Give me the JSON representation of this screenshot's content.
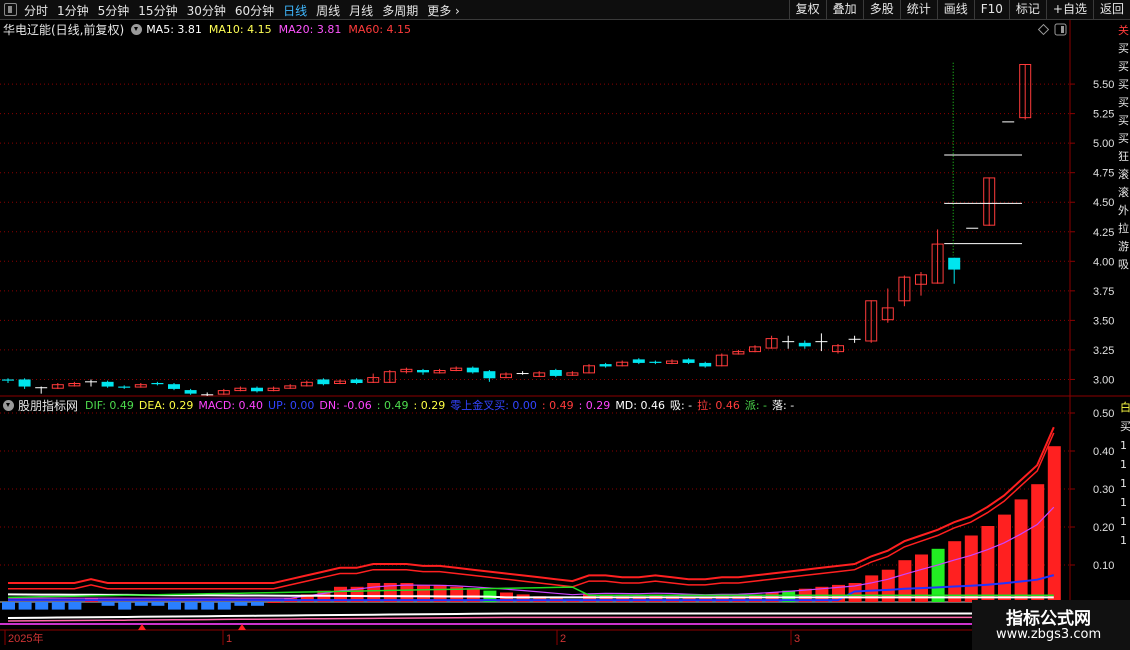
{
  "toolbar": {
    "period_tabs": [
      "分时",
      "1分钟",
      "5分钟",
      "15分钟",
      "30分钟",
      "60分钟",
      "日线",
      "周线",
      "月线",
      "多周期",
      "更多"
    ],
    "active_tab": "日线",
    "right_buttons": [
      "复权",
      "叠加",
      "多股",
      "统计",
      "画线",
      "F10",
      "标记",
      "+自选",
      "返回"
    ]
  },
  "main": {
    "stock_title": "华电辽能(日线,前复权)",
    "ma": [
      {
        "label": "MA5: 3.81",
        "color": "#ffffff"
      },
      {
        "label": "MA10: 4.15",
        "color": "#ffff55"
      },
      {
        "label": "MA20: 3.81",
        "color": "#ff55ff"
      },
      {
        "label": "MA60: 4.15",
        "color": "#ff3b3b"
      }
    ],
    "y_axis": [
      "5.50",
      "5.25",
      "5.00",
      "4.75",
      "4.50",
      "4.25",
      "4.00",
      "3.75",
      "3.50",
      "3.25",
      "3.00"
    ],
    "y_range": [
      2.86,
      5.89
    ],
    "right_strip_chars": [
      "关",
      "买",
      "买",
      "买",
      "买",
      "买",
      "买",
      "狂",
      "滚",
      "滚",
      "外",
      "拉",
      "游",
      "吸"
    ]
  },
  "indicator": {
    "name": "股朋指标网",
    "legend": [
      {
        "text": "DIF: 0.49",
        "color": "#4ddc4d"
      },
      {
        "text": "DEA: 0.29",
        "color": "#ffff44"
      },
      {
        "text": "MACD: 0.40",
        "color": "#ff44ff"
      },
      {
        "text": "UP: 0.00",
        "color": "#3344ff"
      },
      {
        "text": "DN: -0.06",
        "color": "#ff44ff"
      },
      {
        "text": ": 0.49",
        "color": "#4ddc4d"
      },
      {
        "text": ": 0.29",
        "color": "#ffff44"
      },
      {
        "text": "零上金叉买: 0.00",
        "color": "#3344ff"
      },
      {
        "text": ": 0.49",
        "color": "#ff3b3b"
      },
      {
        "text": ": 0.29",
        "color": "#ff44ff"
      },
      {
        "text": "MD: 0.46",
        "color": "#ffffff"
      },
      {
        "text": "吸: -",
        "color": "#ffffff"
      },
      {
        "text": "拉: 0.46",
        "color": "#ff3b3b"
      },
      {
        "text": "派: -",
        "color": "#4ddc4d"
      },
      {
        "text": "落: -",
        "color": "#ffffff"
      }
    ],
    "y_axis": [
      "0.50",
      "0.40",
      "0.30",
      "0.20",
      "0.10"
    ],
    "right_strip_chars": [
      "白",
      "买",
      "1",
      "1",
      "1",
      "1",
      "1",
      "1"
    ]
  },
  "x_axis": [
    "2025年",
    "1",
    "2",
    "3"
  ],
  "watermark": {
    "title": "指标公式网",
    "url": "www.zbgs3.com"
  },
  "colors": {
    "up": "#ff3b3b",
    "down": "#00e5ee",
    "grid": "#8b0000",
    "axis_text": "#e0e0e0"
  },
  "chart_data": [
    {
      "type": "candlestick",
      "title": "华电辽能(日线,前复权)",
      "ylim": [
        2.86,
        5.89
      ],
      "candles": [
        {
          "o": 3.0,
          "c": 2.99,
          "h": 3.01,
          "l": 2.97
        },
        {
          "o": 3.0,
          "c": 2.94,
          "h": 3.01,
          "l": 2.92
        },
        {
          "o": 2.93,
          "c": 2.93,
          "h": 2.94,
          "l": 2.88
        },
        {
          "o": 2.93,
          "c": 2.96,
          "h": 2.97,
          "l": 2.92
        },
        {
          "o": 2.95,
          "c": 2.97,
          "h": 2.98,
          "l": 2.94
        },
        {
          "o": 2.98,
          "c": 2.98,
          "h": 3.0,
          "l": 2.94
        },
        {
          "o": 2.98,
          "c": 2.94,
          "h": 2.99,
          "l": 2.93
        },
        {
          "o": 2.94,
          "c": 2.93,
          "h": 2.95,
          "l": 2.92
        },
        {
          "o": 2.94,
          "c": 2.96,
          "h": 2.97,
          "l": 2.93
        },
        {
          "o": 2.97,
          "c": 2.96,
          "h": 2.98,
          "l": 2.95
        },
        {
          "o": 2.96,
          "c": 2.92,
          "h": 2.97,
          "l": 2.91
        },
        {
          "o": 2.91,
          "c": 2.88,
          "h": 2.92,
          "l": 2.87
        },
        {
          "o": 2.87,
          "c": 2.87,
          "h": 2.89,
          "l": 2.86
        },
        {
          "o": 2.88,
          "c": 2.91,
          "h": 2.92,
          "l": 2.87
        },
        {
          "o": 2.91,
          "c": 2.93,
          "h": 2.94,
          "l": 2.9
        },
        {
          "o": 2.93,
          "c": 2.9,
          "h": 2.94,
          "l": 2.89
        },
        {
          "o": 2.91,
          "c": 2.93,
          "h": 2.94,
          "l": 2.9
        },
        {
          "o": 2.93,
          "c": 2.95,
          "h": 2.96,
          "l": 2.92
        },
        {
          "o": 2.95,
          "c": 2.98,
          "h": 2.99,
          "l": 2.94
        },
        {
          "o": 3.0,
          "c": 2.96,
          "h": 3.01,
          "l": 2.95
        },
        {
          "o": 2.97,
          "c": 2.99,
          "h": 3.0,
          "l": 2.96
        },
        {
          "o": 3.0,
          "c": 2.97,
          "h": 3.01,
          "l": 2.96
        },
        {
          "o": 2.98,
          "c": 3.02,
          "h": 3.05,
          "l": 2.97
        },
        {
          "o": 2.98,
          "c": 3.07,
          "h": 3.08,
          "l": 2.97
        },
        {
          "o": 3.07,
          "c": 3.09,
          "h": 3.1,
          "l": 3.05
        },
        {
          "o": 3.08,
          "c": 3.06,
          "h": 3.09,
          "l": 3.04
        },
        {
          "o": 3.06,
          "c": 3.08,
          "h": 3.09,
          "l": 3.05
        },
        {
          "o": 3.08,
          "c": 3.1,
          "h": 3.11,
          "l": 3.07
        },
        {
          "o": 3.1,
          "c": 3.06,
          "h": 3.11,
          "l": 3.05
        },
        {
          "o": 3.07,
          "c": 3.01,
          "h": 3.08,
          "l": 2.98
        },
        {
          "o": 3.02,
          "c": 3.05,
          "h": 3.06,
          "l": 3.01
        },
        {
          "o": 3.05,
          "c": 3.05,
          "h": 3.07,
          "l": 3.04
        },
        {
          "o": 3.03,
          "c": 3.06,
          "h": 3.07,
          "l": 3.02
        },
        {
          "o": 3.08,
          "c": 3.03,
          "h": 3.09,
          "l": 3.02
        },
        {
          "o": 3.04,
          "c": 3.06,
          "h": 3.07,
          "l": 3.03
        },
        {
          "o": 3.06,
          "c": 3.12,
          "h": 3.13,
          "l": 3.05
        },
        {
          "o": 3.13,
          "c": 3.11,
          "h": 3.14,
          "l": 3.1
        },
        {
          "o": 3.12,
          "c": 3.15,
          "h": 3.16,
          "l": 3.11
        },
        {
          "o": 3.17,
          "c": 3.14,
          "h": 3.18,
          "l": 3.13
        },
        {
          "o": 3.15,
          "c": 3.14,
          "h": 3.16,
          "l": 3.13
        },
        {
          "o": 3.14,
          "c": 3.16,
          "h": 3.17,
          "l": 3.13
        },
        {
          "o": 3.17,
          "c": 3.14,
          "h": 3.18,
          "l": 3.13
        },
        {
          "o": 3.14,
          "c": 3.11,
          "h": 3.15,
          "l": 3.1
        },
        {
          "o": 3.12,
          "c": 3.21,
          "h": 3.22,
          "l": 3.11
        },
        {
          "o": 3.22,
          "c": 3.24,
          "h": 3.25,
          "l": 3.21
        },
        {
          "o": 3.24,
          "c": 3.28,
          "h": 3.29,
          "l": 3.23
        },
        {
          "o": 3.27,
          "c": 3.35,
          "h": 3.37,
          "l": 3.26
        },
        {
          "o": 3.32,
          "c": 3.32,
          "h": 3.37,
          "l": 3.26
        },
        {
          "o": 3.31,
          "c": 3.28,
          "h": 3.33,
          "l": 3.26
        },
        {
          "o": 3.32,
          "c": 3.32,
          "h": 3.39,
          "l": 3.24
        },
        {
          "o": 3.24,
          "c": 3.29,
          "h": 3.3,
          "l": 3.22
        },
        {
          "o": 3.34,
          "c": 3.34,
          "h": 3.37,
          "l": 3.31
        },
        {
          "o": 3.33,
          "c": 3.67,
          "h": 3.67,
          "l": 3.31
        },
        {
          "o": 3.51,
          "c": 3.61,
          "h": 3.77,
          "l": 3.48
        },
        {
          "o": 3.67,
          "c": 3.87,
          "h": 3.88,
          "l": 3.62
        },
        {
          "o": 3.81,
          "c": 3.89,
          "h": 3.91,
          "l": 3.71
        },
        {
          "o": 3.82,
          "c": 4.15,
          "h": 4.27,
          "l": 3.81
        },
        {
          "o": 4.03,
          "c": 3.93,
          "h": 4.03,
          "l": 3.81
        }
      ],
      "gap_bars": [
        {
          "o": 4.28,
          "c": 4.28,
          "h": 4.28,
          "l": 4.28
        },
        {
          "o": 4.31,
          "c": 4.71,
          "h": 4.71,
          "l": 4.3
        },
        {
          "o": 5.18,
          "c": 5.18,
          "h": 5.18,
          "l": 5.18
        },
        {
          "o": 5.22,
          "c": 5.67,
          "h": 5.67,
          "l": 5.2
        }
      ],
      "h_lines": [
        4.9,
        4.49,
        4.15
      ],
      "v_marker_value_top": 5.68
    },
    {
      "type": "bar",
      "title": "股朋指标网",
      "ylim": [
        0,
        0.5
      ],
      "values": [
        -0.02,
        -0.02,
        -0.02,
        -0.02,
        -0.02,
        0.01,
        -0.01,
        -0.02,
        -0.01,
        -0.01,
        -0.02,
        -0.02,
        -0.02,
        -0.02,
        -0.01,
        -0.01,
        0.0,
        0.01,
        0.02,
        0.03,
        0.04,
        0.04,
        0.05,
        0.05,
        0.05,
        0.045,
        0.045,
        0.04,
        0.035,
        0.03,
        0.025,
        0.02,
        0.015,
        0.01,
        0.005,
        0.02,
        0.02,
        0.015,
        0.015,
        0.02,
        0.015,
        0.01,
        0.01,
        0.015,
        0.015,
        0.02,
        0.025,
        0.03,
        0.035,
        0.04,
        0.045,
        0.05,
        0.07,
        0.085,
        0.11,
        0.125,
        0.14,
        0.16,
        0.175,
        0.2,
        0.23,
        0.27,
        0.31,
        0.41
      ],
      "bar_colors": {
        "pos": "#ff2020",
        "neg": "#2a7fff",
        "cross": "#22ee22"
      }
    }
  ]
}
